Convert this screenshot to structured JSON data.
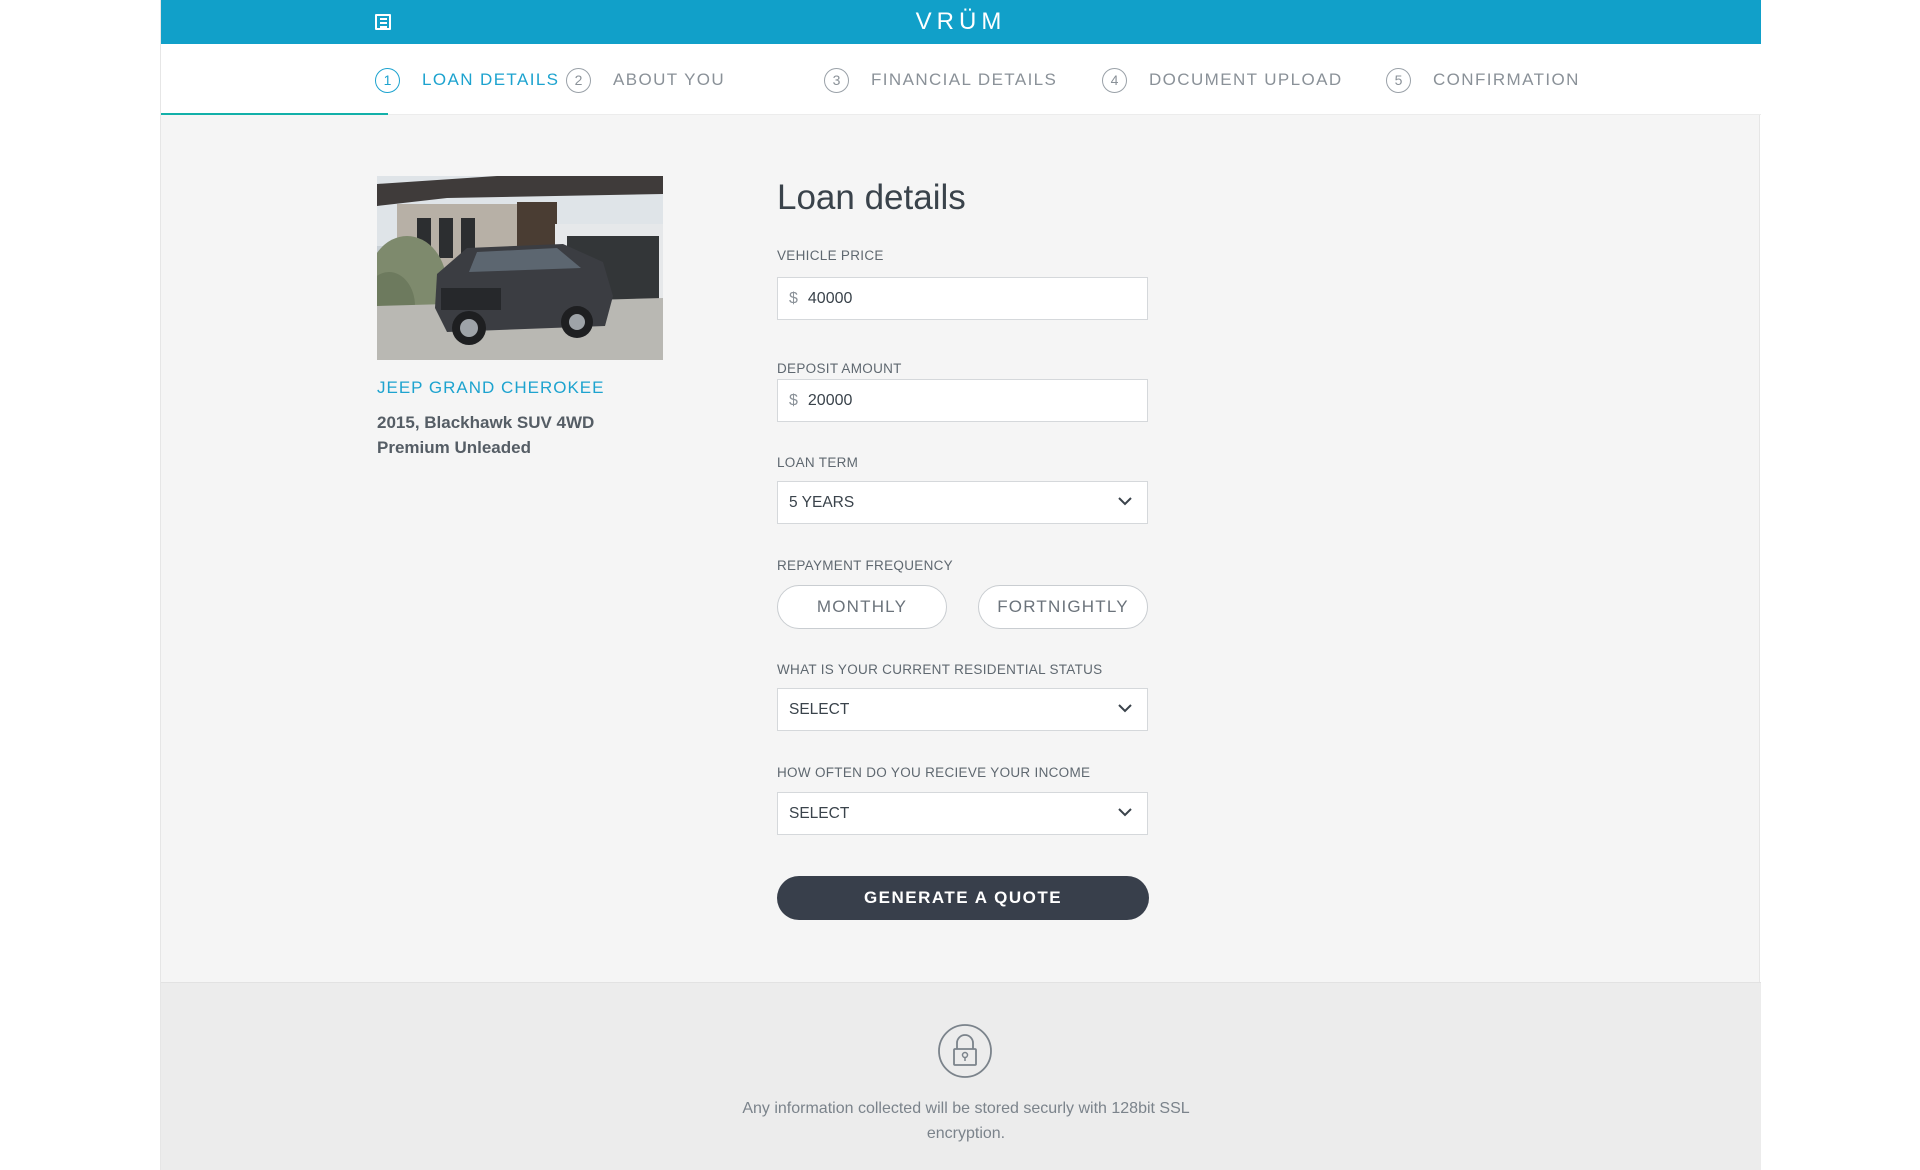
{
  "header": {
    "brand": "VRÜM",
    "menu_icon": "menu-icon",
    "bar_color": "#11a0c9"
  },
  "steps": [
    {
      "number": "1",
      "label": "LOAN DETAILS",
      "active": true
    },
    {
      "number": "2",
      "label": "ABOUT YOU",
      "active": false
    },
    {
      "number": "3",
      "label": "FINANCIAL DETAILS",
      "active": false
    },
    {
      "number": "4",
      "label": "DOCUMENT UPLOAD",
      "active": false
    },
    {
      "number": "5",
      "label": "CONFIRMATION",
      "active": false
    }
  ],
  "vehicle": {
    "name": "JEEP GRAND CHEROKEE",
    "description": "2015, Blackhawk SUV 4WD Premium Unleaded"
  },
  "form": {
    "title": "Loan details",
    "vehicle_price": {
      "label": "VEHICLE PRICE",
      "currency": "$",
      "value": "40000"
    },
    "deposit_amount": {
      "label": "DEPOSIT AMOUNT",
      "currency": "$",
      "value": "20000"
    },
    "loan_term": {
      "label": "LOAN TERM",
      "value": "5 YEARS"
    },
    "repayment_frequency": {
      "label": "REPAYMENT FREQUENCY",
      "options": [
        "MONTHLY",
        "FORTNIGHTLY"
      ]
    },
    "residential_status": {
      "label": "WHAT IS YOUR CURRENT RESIDENTIAL STATUS",
      "value": "SELECT"
    },
    "income_frequency": {
      "label": "HOW OFTEN DO YOU RECIEVE YOUR INCOME",
      "value": "SELECT"
    },
    "submit_label": "GENERATE A QUOTE"
  },
  "footer": {
    "icon": "lock-icon",
    "text": "Any information collected will be stored securly with 128bit SSL encryption."
  },
  "colors": {
    "accent": "#1da3cf",
    "progress": "#12b0a9",
    "button": "#383f4b"
  }
}
